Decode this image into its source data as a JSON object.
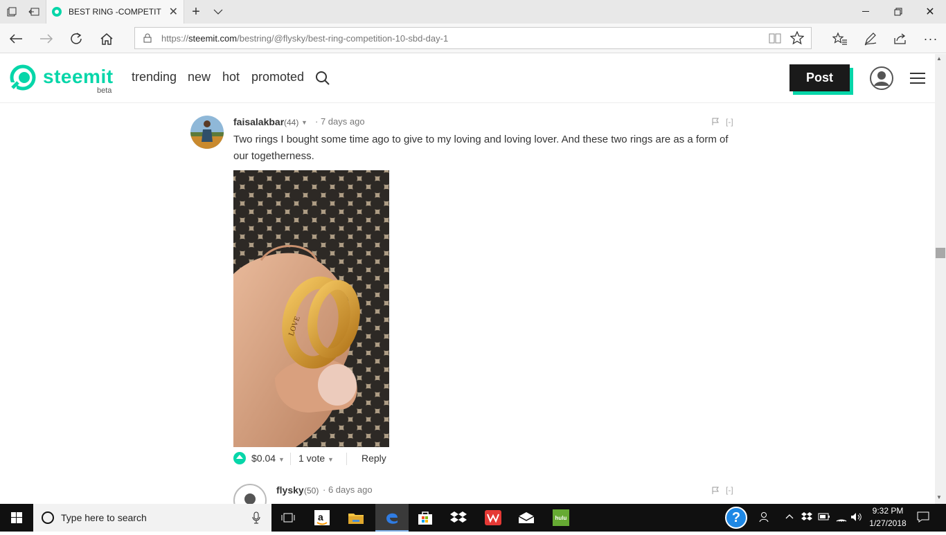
{
  "browser": {
    "tab_title": "BEST RING -COMPETITIO",
    "url_prefix": "https://",
    "url_host": "steemit.com",
    "url_path": "/bestring/@flysky/best-ring-competition-10-sbd-day-1"
  },
  "site": {
    "logo": "steemit",
    "beta": "beta",
    "nav": [
      "trending",
      "new",
      "hot",
      "promoted"
    ],
    "post_label": "Post",
    "accent": "#06d6a9"
  },
  "comments": [
    {
      "author": "faisalakbar",
      "rep": "(44)",
      "time": "7 days ago",
      "collapse": "[-]",
      "body": "Two rings I bought some time ago to give to my loving and loving lover. And these two rings are as a form of our togetherness.",
      "payout": "$0.04",
      "votes": "1 vote",
      "reply": "Reply"
    },
    {
      "author": "flysky",
      "rep": "(50)",
      "time": "6 days ago",
      "collapse": "[-]"
    }
  ],
  "taskbar": {
    "search_placeholder": "Type here to search",
    "time": "9:32 PM",
    "date": "1/27/2018",
    "apps": [
      "task-view",
      "amazon",
      "file-explorer",
      "edge",
      "store",
      "dropbox",
      "wps",
      "mail",
      "hulu"
    ],
    "hulu_label": "hulu"
  }
}
